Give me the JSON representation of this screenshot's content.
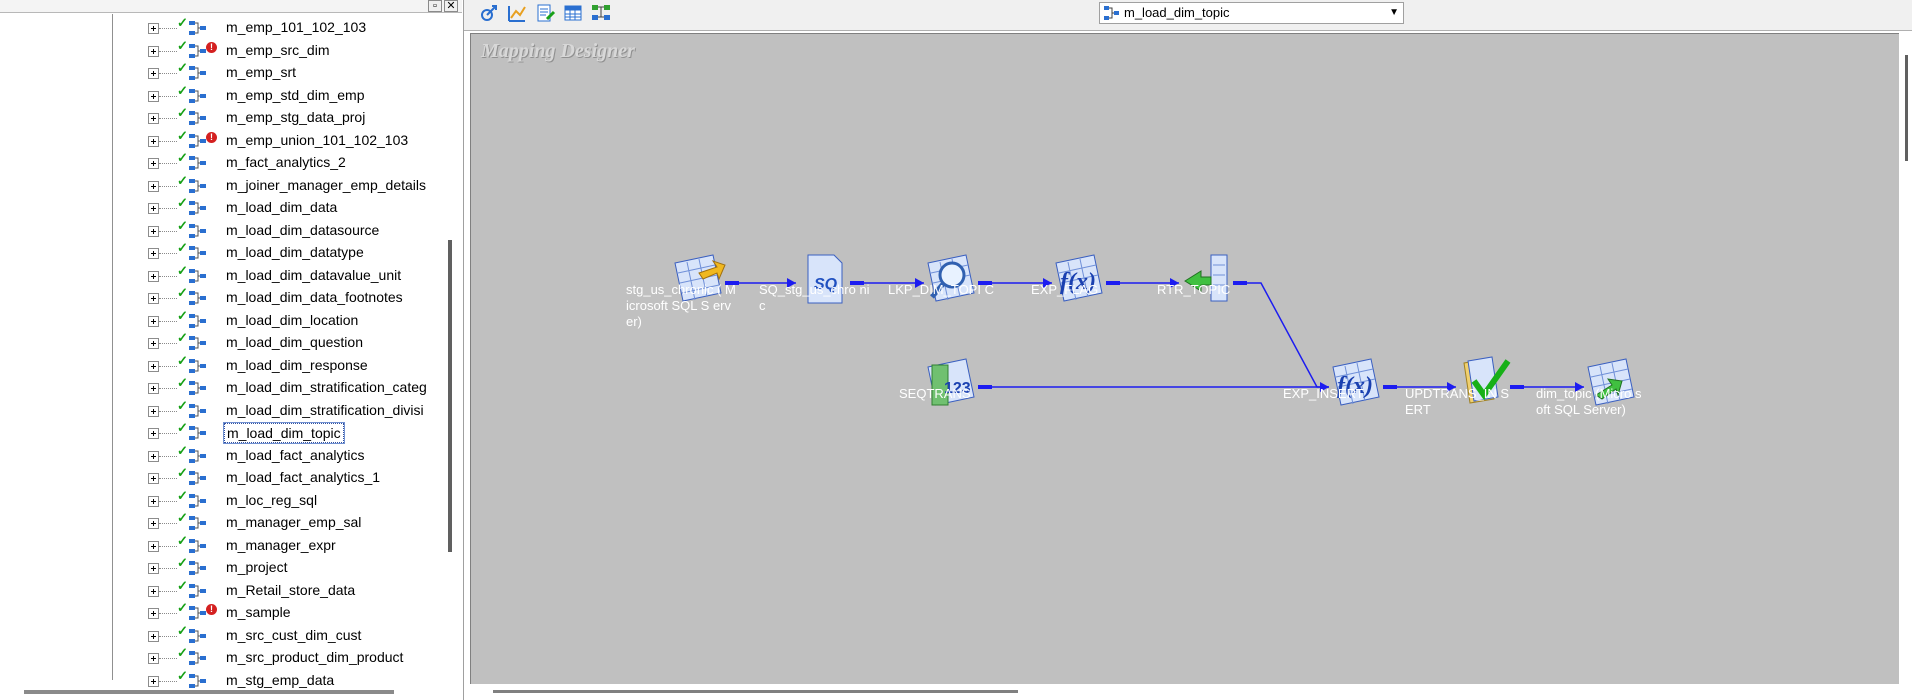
{
  "navigator": {
    "close_glyph": "✕",
    "pin_glyph": "▫",
    "items": [
      {
        "label": "m_emp_101_102_103",
        "valid": true,
        "error": false,
        "selected": false
      },
      {
        "label": "m_emp_src_dim",
        "valid": true,
        "error": true,
        "selected": false
      },
      {
        "label": "m_emp_srt",
        "valid": true,
        "error": false,
        "selected": false
      },
      {
        "label": "m_emp_std_dim_emp",
        "valid": true,
        "error": false,
        "selected": false
      },
      {
        "label": "m_emp_stg_data_proj",
        "valid": true,
        "error": false,
        "selected": false
      },
      {
        "label": "m_emp_union_101_102_103",
        "valid": true,
        "error": true,
        "selected": false
      },
      {
        "label": "m_fact_analytics_2",
        "valid": true,
        "error": false,
        "selected": false
      },
      {
        "label": "m_joiner_manager_emp_details",
        "valid": true,
        "error": false,
        "selected": false
      },
      {
        "label": "m_load_dim_data",
        "valid": true,
        "error": false,
        "selected": false
      },
      {
        "label": "m_load_dim_datasource",
        "valid": true,
        "error": false,
        "selected": false
      },
      {
        "label": "m_load_dim_datatype",
        "valid": true,
        "error": false,
        "selected": false
      },
      {
        "label": "m_load_dim_datavalue_unit",
        "valid": true,
        "error": false,
        "selected": false
      },
      {
        "label": "m_load_dim_data_footnotes",
        "valid": true,
        "error": false,
        "selected": false
      },
      {
        "label": "m_load_dim_location",
        "valid": true,
        "error": false,
        "selected": false
      },
      {
        "label": "m_load_dim_question",
        "valid": true,
        "error": false,
        "selected": false
      },
      {
        "label": "m_load_dim_response",
        "valid": true,
        "error": false,
        "selected": false
      },
      {
        "label": "m_load_dim_stratification_categ",
        "valid": true,
        "error": false,
        "selected": false
      },
      {
        "label": "m_load_dim_stratification_divisi",
        "valid": true,
        "error": false,
        "selected": false
      },
      {
        "label": "m_load_dim_topic",
        "valid": true,
        "error": false,
        "selected": true
      },
      {
        "label": "m_load_fact_analytics",
        "valid": true,
        "error": false,
        "selected": false
      },
      {
        "label": "m_load_fact_analytics_1",
        "valid": true,
        "error": false,
        "selected": false
      },
      {
        "label": "m_loc_reg_sql",
        "valid": true,
        "error": false,
        "selected": false
      },
      {
        "label": "m_manager_emp_sal",
        "valid": true,
        "error": false,
        "selected": false
      },
      {
        "label": "m_manager_expr",
        "valid": true,
        "error": false,
        "selected": false
      },
      {
        "label": "m_project",
        "valid": true,
        "error": false,
        "selected": false
      },
      {
        "label": "m_Retail_store_data",
        "valid": true,
        "error": false,
        "selected": false
      },
      {
        "label": "m_sample",
        "valid": true,
        "error": true,
        "selected": false
      },
      {
        "label": "m_src_cust_dim_cust",
        "valid": true,
        "error": false,
        "selected": false
      },
      {
        "label": "m_src_product_dim_product",
        "valid": true,
        "error": false,
        "selected": false
      },
      {
        "label": "m_stg_emp_data",
        "valid": true,
        "error": false,
        "selected": false
      }
    ]
  },
  "toolbar": {
    "buttons": [
      {
        "icon": "arrange-icon"
      },
      {
        "icon": "transformation-wizard-icon"
      },
      {
        "icon": "edit-icon"
      },
      {
        "icon": "table-icon"
      },
      {
        "icon": "mapping-layout-icon",
        "active": true
      }
    ],
    "mapping_select": {
      "value": "m_load_dim_topic"
    }
  },
  "designer": {
    "title": "Mapping Designer",
    "transformations": [
      {
        "id": "src",
        "label": "stg_us_chronic ( Microsoft SQL S erver)",
        "icon": "source-icon"
      },
      {
        "id": "sq",
        "label": "SQ_stg_us_chro nic",
        "icon": "source-qualifier-icon"
      },
      {
        "id": "lkp",
        "label": "LKP_DIM_TOPI C",
        "icon": "lookup-icon"
      },
      {
        "id": "expflag",
        "label": "EXP_FLAG",
        "icon": "expression-icon"
      },
      {
        "id": "rtr",
        "label": "RTR_TOPIC",
        "icon": "router-icon"
      },
      {
        "id": "seq",
        "label": "SEQTRANS",
        "icon": "sequence-icon"
      },
      {
        "id": "expins",
        "label": "EXP_INSERT",
        "icon": "expression-icon"
      },
      {
        "id": "upd",
        "label": "UPDTRANS_IN SERT",
        "icon": "update-strategy-icon"
      },
      {
        "id": "tgt",
        "label": "dim_topic (Micro soft SQL Server)",
        "icon": "target-icon"
      }
    ],
    "link_color": "#1c1cf0"
  }
}
